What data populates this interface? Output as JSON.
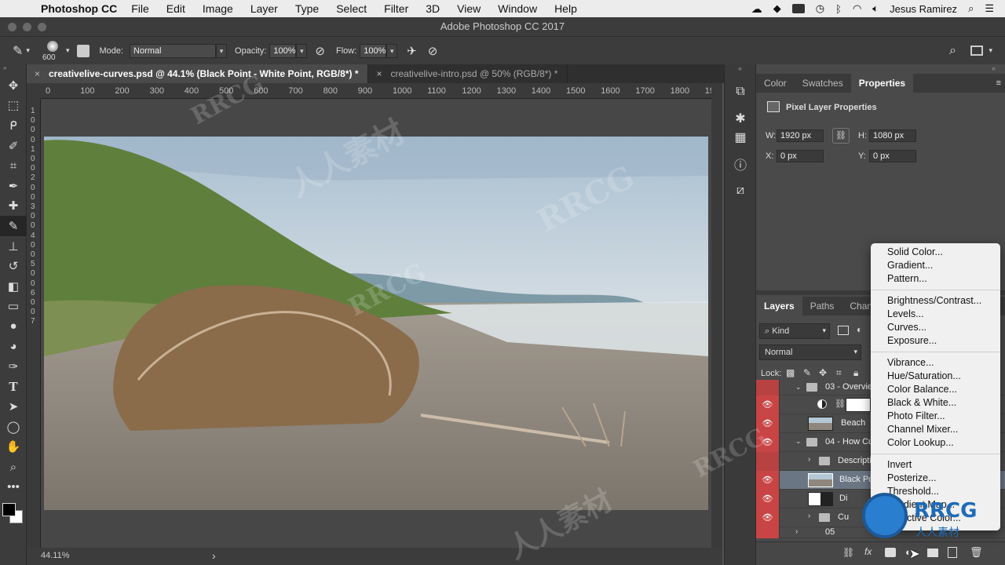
{
  "menubar": {
    "app_name": "Photoshop CC",
    "items": [
      "File",
      "Edit",
      "Image",
      "Layer",
      "Type",
      "Select",
      "Filter",
      "3D",
      "View",
      "Window",
      "Help"
    ],
    "user": "Jesus Ramirez"
  },
  "window": {
    "title": "Adobe Photoshop CC 2017"
  },
  "options": {
    "brush_size": "600",
    "mode_label": "Mode:",
    "mode_value": "Normal",
    "opacity_label": "Opacity:",
    "opacity_value": "100%",
    "flow_label": "Flow:",
    "flow_value": "100%"
  },
  "tabs": [
    {
      "label": "creativelive-curves.psd @ 44.1% (Black Point - White Point, RGB/8*) *",
      "close": "×"
    },
    {
      "label": "creativelive-intro.psd @ 50% (RGB/8*) *",
      "close": "×"
    }
  ],
  "ruler": {
    "top": [
      "0",
      "100",
      "200",
      "300",
      "400",
      "500",
      "600",
      "700",
      "800",
      "900",
      "1000",
      "1100",
      "1200",
      "1300",
      "1400",
      "1500",
      "1600",
      "1700",
      "1800",
      "19"
    ],
    "left": [
      "1",
      "0",
      "0",
      "0",
      "1",
      "0",
      "0",
      "2",
      "0",
      "0",
      "3",
      "0",
      "0",
      "4",
      "0",
      "0",
      "5",
      "0",
      "0",
      "6",
      "0",
      "0",
      "7"
    ]
  },
  "status": {
    "zoom": "44.11%",
    "arrow": "›"
  },
  "properties": {
    "tabs": [
      "Color",
      "Swatches",
      "Properties"
    ],
    "title": "Pixel Layer Properties",
    "w_label": "W:",
    "w_value": "1920 px",
    "h_label": "H:",
    "h_value": "1080 px",
    "x_label": "X:",
    "x_value": "0 px",
    "y_label": "Y:",
    "y_value": "0 px"
  },
  "layers": {
    "tabs": [
      "Layers",
      "Paths",
      "Channe"
    ],
    "kind_label": "Kind",
    "blend_mode": "Normal",
    "lock_label": "Lock:",
    "rows": [
      {
        "name": "03 - Overvie"
      },
      {
        "name": ""
      },
      {
        "name": "Beach"
      },
      {
        "name": "04 - How Cu"
      },
      {
        "name": "Descripti"
      },
      {
        "name": "Black Po"
      },
      {
        "name": "Di"
      },
      {
        "name": "Cu"
      },
      {
        "name": "05"
      }
    ]
  },
  "popup_menu": {
    "groups": [
      [
        "Solid Color...",
        "Gradient...",
        "Pattern..."
      ],
      [
        "Brightness/Contrast...",
        "Levels...",
        "Curves...",
        "Exposure..."
      ],
      [
        "Vibrance...",
        "Hue/Saturation...",
        "Color Balance...",
        "Black & White...",
        "Photo Filter...",
        "Channel Mixer...",
        "Color Lookup..."
      ],
      [
        "Invert",
        "Posterize...",
        "Threshold...",
        "Gradient Map...",
        "Selective Color..."
      ]
    ]
  },
  "watermark": {
    "text_cn": "人人素材",
    "text_en": "RRCG"
  },
  "colors": {
    "eye_red": "#c94444",
    "selected_row": "#6a7684",
    "menu_bg": "#f0f0f0"
  }
}
